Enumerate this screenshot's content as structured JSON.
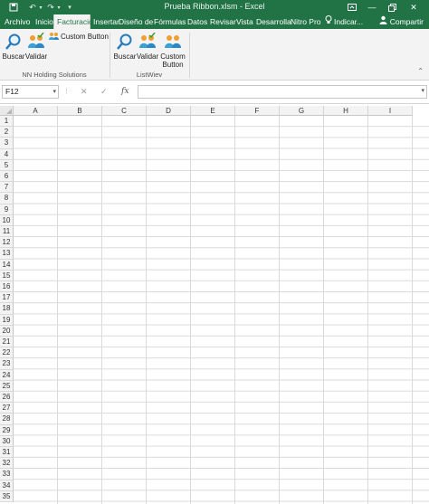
{
  "window": {
    "title": "Prueba Ribbon.xlsm - Excel",
    "quick_access": [
      "save-icon",
      "undo-icon",
      "redo-icon",
      "customize-icon"
    ],
    "controls": [
      "ribbon-display-icon",
      "minimize-icon",
      "restore-icon",
      "close-icon"
    ]
  },
  "tabs": {
    "items": [
      {
        "label": "Archivo"
      },
      {
        "label": "Inicio"
      },
      {
        "label": "Facturacic"
      },
      {
        "label": "Insertar"
      },
      {
        "label": "Diseño de"
      },
      {
        "label": "Fórmulas"
      },
      {
        "label": "Datos"
      },
      {
        "label": "Revisar"
      },
      {
        "label": "Vista"
      },
      {
        "label": "Desarrolla"
      },
      {
        "label": "Nitro Pro"
      },
      {
        "label": "Indicar..."
      }
    ],
    "active": "Facturacic",
    "share_label": "Compartir"
  },
  "ribbon": {
    "group1": {
      "label": "NN Holding Solutions",
      "buscar": "Buscar",
      "validar": "Validar",
      "custom": "Custom Button"
    },
    "group2": {
      "label": "ListWiev",
      "buscar": "Buscar",
      "validar": "Validar",
      "custom_line1": "Custom",
      "custom_line2": "Button"
    }
  },
  "formula_bar": {
    "name_box": "F12",
    "fx": "fx",
    "value": ""
  },
  "grid": {
    "columns": [
      "A",
      "B",
      "C",
      "D",
      "E",
      "F",
      "G",
      "H",
      "I"
    ],
    "rows": [
      "1",
      "2",
      "3",
      "4",
      "5",
      "6",
      "7",
      "8",
      "9",
      "10",
      "11",
      "12",
      "13",
      "14",
      "15",
      "16",
      "17",
      "18",
      "19",
      "20",
      "21",
      "22",
      "23",
      "24",
      "25",
      "26",
      "27",
      "28",
      "29",
      "30",
      "31",
      "32",
      "33",
      "34",
      "35"
    ]
  },
  "colors": {
    "accent": "#217346",
    "ribbon_bg": "#f3f3f3",
    "gridline": "#dadada"
  }
}
